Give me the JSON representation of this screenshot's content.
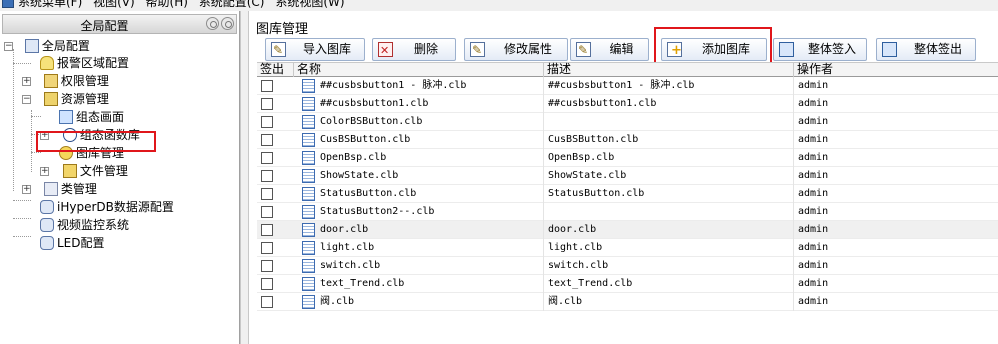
{
  "menubar": {
    "items": [
      "系统菜单(F)",
      "视图(V)",
      "帮助(H)",
      "系统配置(C)",
      "系统视图(W)"
    ]
  },
  "left_panel": {
    "title": "全局配置",
    "tree": [
      {
        "label": "全局配置",
        "icon": "root-config-icon"
      },
      {
        "label": "报警区域配置",
        "icon": "bell-icon"
      },
      {
        "label": "权限管理",
        "icon": "permission-icon"
      },
      {
        "label": "资源管理",
        "icon": "resource-icon"
      },
      {
        "label": "组态画面",
        "icon": "screen-icon"
      },
      {
        "label": "组态函数库",
        "icon": "function-icon"
      },
      {
        "label": "图库管理",
        "icon": "library-icon"
      },
      {
        "label": "文件管理",
        "icon": "file-icon"
      },
      {
        "label": "类管理",
        "icon": "class-icon"
      },
      {
        "label": "iHyperDB数据源配置",
        "icon": "database-icon"
      },
      {
        "label": "视频监控系统",
        "icon": "database-icon"
      },
      {
        "label": "LED配置",
        "icon": "database-icon"
      }
    ]
  },
  "main": {
    "title": "图库管理",
    "toolbar": {
      "import": "导入图库",
      "delete": "删除",
      "modify": "修改属性",
      "edit": "编辑",
      "add": "添加图库",
      "checkin": "整体签入",
      "checkout": "整体签出"
    },
    "columns": [
      "签出",
      "名称",
      "描述",
      "操作者"
    ],
    "rows": [
      {
        "name": "##cusbsbutton1 - 脉冲.clb",
        "desc": "##cusbsbutton1 - 脉冲.clb",
        "op": "admin"
      },
      {
        "name": "##cusbsbutton1.clb",
        "desc": "##cusbsbutton1.clb",
        "op": "admin"
      },
      {
        "name": "ColorBSButton.clb",
        "desc": "",
        "op": "admin"
      },
      {
        "name": "CusBSButton.clb",
        "desc": "CusBSButton.clb",
        "op": "admin"
      },
      {
        "name": "OpenBsp.clb",
        "desc": "OpenBsp.clb",
        "op": "admin"
      },
      {
        "name": "ShowState.clb",
        "desc": "ShowState.clb",
        "op": "admin"
      },
      {
        "name": "StatusButton.clb",
        "desc": "StatusButton.clb",
        "op": "admin"
      },
      {
        "name": "StatusButton2--.clb",
        "desc": "",
        "op": "admin"
      },
      {
        "name": "door.clb",
        "desc": "door.clb",
        "op": "admin"
      },
      {
        "name": "light.clb",
        "desc": "light.clb",
        "op": "admin"
      },
      {
        "name": "switch.clb",
        "desc": "switch.clb",
        "op": "admin"
      },
      {
        "name": "text_Trend.clb",
        "desc": "text_Trend.clb",
        "op": "admin"
      },
      {
        "name": "阀.clb",
        "desc": "阀.clb",
        "op": "admin"
      }
    ]
  }
}
